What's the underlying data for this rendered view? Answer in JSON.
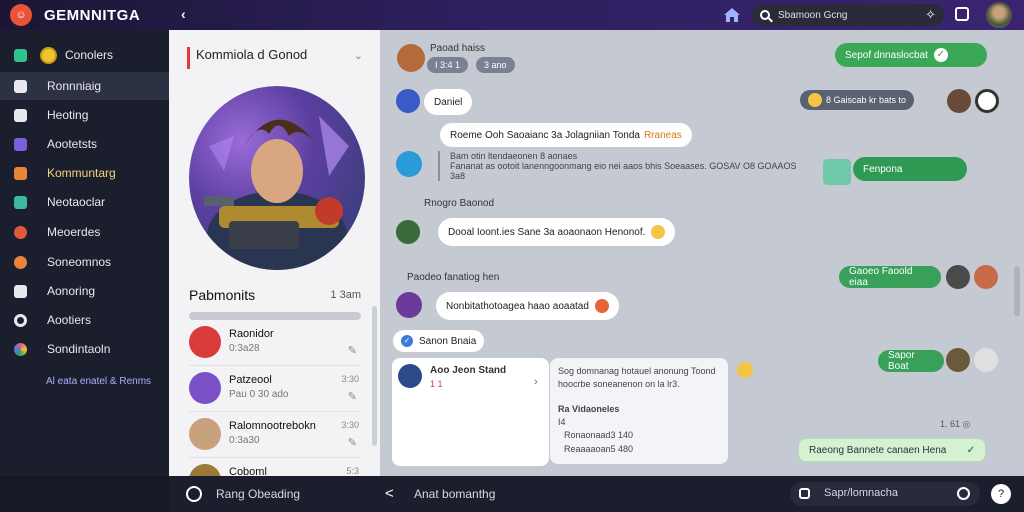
{
  "app": {
    "title": "GEMNNITGA"
  },
  "search": {
    "placeholder": "Sbamoon Gcng"
  },
  "sidebar": {
    "items": [
      {
        "label": "Conolers",
        "color": "#f1c232"
      },
      {
        "label": "Ronnniaig",
        "color": "#ffffff"
      },
      {
        "label": "Heoting",
        "color": "#ffffff"
      },
      {
        "label": "Aootetsts",
        "color": "#7b5fe0"
      },
      {
        "label": "Kommuntarg",
        "color": "#e8853a"
      },
      {
        "label": "Neotaoclar",
        "color": "#3ab8a0"
      },
      {
        "label": "Meoerdes",
        "color": "#e05a3a"
      },
      {
        "label": "Soneomnos",
        "color": "#e8853a"
      },
      {
        "label": "Aonoring",
        "color": "#ffffff"
      },
      {
        "label": "Aootiers",
        "color": "#ffffff"
      },
      {
        "label": "Sondintaoln",
        "color": "#e05a8a"
      }
    ],
    "footer": "Al eata enatel & Renms"
  },
  "midpanel": {
    "header": "Kommiola d Gonod",
    "section_title": "Pabmonits",
    "section_meta": "1 3am",
    "contacts": [
      {
        "name": "Raonidor",
        "sub": "0:3a28",
        "time": "",
        "color": "#d93a3a"
      },
      {
        "name": "Patzeool",
        "sub": "Pau 0 30 ado",
        "time": "3:30",
        "color": "#7a4fc8"
      },
      {
        "name": "Ralomnootrebokn",
        "sub": "0:3a30",
        "time": "3:30",
        "color": "#c8a27c"
      },
      {
        "name": "Coboml",
        "sub": "",
        "time": "5:3",
        "color": "#9b7a3a"
      }
    ]
  },
  "chat": {
    "sender_top": {
      "name": "Paoad haiss",
      "tag1": "I 3:4 1",
      "tag2": "3 ano"
    },
    "msg_green_top": "Sepof dnnaslocbat",
    "msg_daniel": "Daniel",
    "pill_right": "8 Gaiscab kr bats to",
    "msg_quote": "Roeme Ooh Saoaianc 3a Jolagniian Tonda",
    "msg_quote_highlight": "Rraneas",
    "thread": {
      "line1": "Bam otin ltendaeonen 8 aonaes",
      "line2": "Fananat as ootoit lanenngoonmang eio nei aaos bhis Soeaases. GOSAV O8 GOAAOS",
      "line3": "3a8"
    },
    "msg_fenpona": "Fenpona",
    "label_1": "Rnogro Baonod",
    "msg_dooal": "Dooal Ioont.ies Sane 3a aoaonaon Henonof.",
    "label_2": "Paodeo fanatiog hen",
    "msg_green_mid": "Gaoeo Faoold eiaa",
    "msg_nonbi": "Nonbitathotoagea haao aoaatad",
    "msg_green_low": "Sapor Boat",
    "chip": "Sanon Bnaia",
    "card_left": {
      "name": "Aoo Jeon Stand",
      "meta": "1 1"
    },
    "card_right": {
      "line1": "Sog domnanag hotauel anonung Toond",
      "line2": "hoocrbe soneanenon on la lr3.",
      "sub_title": "Ra Vidaoneles",
      "item1": "Ronaonaad3 140",
      "item2": "Reaaaaoan5 480",
      "lead": "I4"
    },
    "stamp": "1. 61 ◎",
    "msg_final": "Raeong Bannete canaen Hena"
  },
  "bottombar": {
    "left": "Rang Obeading",
    "mid": "Anat bomanthg",
    "input_placeholder": "Sapr/lomnacha"
  }
}
